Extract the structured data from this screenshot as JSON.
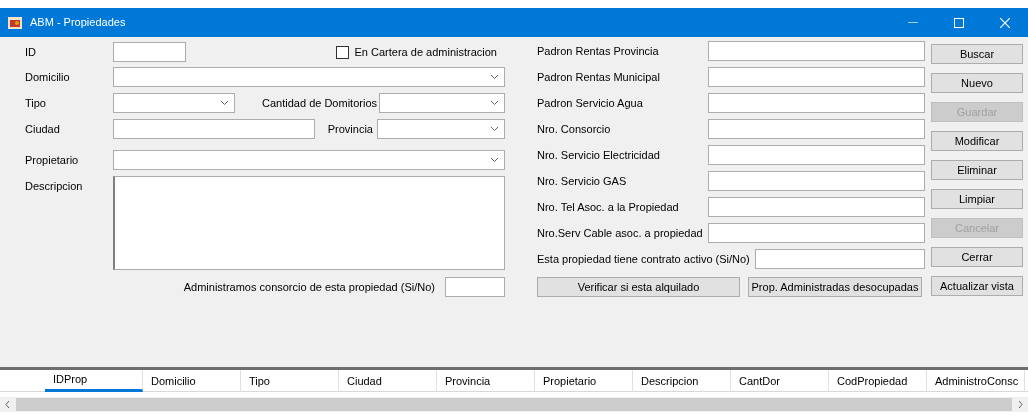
{
  "window": {
    "title": "ABM - Propiedades"
  },
  "form": {
    "id_field": {
      "label": "ID"
    },
    "en_cartera": {
      "label": "En Cartera de administracion",
      "checked": false
    },
    "domicilio": {
      "label": "Domicilio"
    },
    "tipo": {
      "label": "Tipo"
    },
    "cantidad_dormitorios": {
      "label": "Cantidad de Domitorios"
    },
    "ciudad": {
      "label": "Ciudad"
    },
    "provincia": {
      "label": "Provincia"
    },
    "propietario": {
      "label": "Propietario"
    },
    "descripcion": {
      "label": "Descripcion"
    },
    "administramos_consorcio": {
      "label": "Administramos consorcio de esta propiedad (Si/No)"
    }
  },
  "right_fields": [
    {
      "label": "Padron Rentas Provincia"
    },
    {
      "label": "Padron Rentas Municipal"
    },
    {
      "label": "Padron Servicio Agua"
    },
    {
      "label": "Nro. Consorcio"
    },
    {
      "label": "Nro. Servicio Electricidad"
    },
    {
      "label": "Nro. Servicio GAS"
    },
    {
      "label": "Nro. Tel Asoc. a la Propiedad"
    },
    {
      "label": "Nro.Serv Cable  asoc. a propiedad"
    },
    {
      "label": "Esta propiedad tiene contrato activo (Si/No)"
    }
  ],
  "bottom_buttons": [
    {
      "label": "Verificar si esta alquilado"
    },
    {
      "label": "Prop. Administradas desocupadas"
    }
  ],
  "action_buttons": [
    {
      "label": "Buscar",
      "disabled": false
    },
    {
      "label": "Nuevo",
      "disabled": false
    },
    {
      "label": "Guardar",
      "disabled": true
    },
    {
      "label": "Modificar",
      "disabled": false
    },
    {
      "label": "Eliminar",
      "disabled": false
    },
    {
      "label": "Limpiar",
      "disabled": false
    },
    {
      "label": "Cancelar",
      "disabled": true
    },
    {
      "label": "Cerrar",
      "disabled": false
    },
    {
      "label": "Actualizar vista",
      "disabled": false
    }
  ],
  "table": {
    "columns": [
      {
        "label": "IDProp",
        "selected": true
      },
      {
        "label": "Domicilio",
        "selected": false
      },
      {
        "label": "Tipo",
        "selected": false
      },
      {
        "label": "Ciudad",
        "selected": false
      },
      {
        "label": "Provincia",
        "selected": false
      },
      {
        "label": "Propietario",
        "selected": false
      },
      {
        "label": "Descripcion",
        "selected": false
      },
      {
        "label": "CantDor",
        "selected": false
      },
      {
        "label": "CodPropiedad",
        "selected": false
      },
      {
        "label": "AdministroConsc",
        "selected": false
      }
    ]
  }
}
